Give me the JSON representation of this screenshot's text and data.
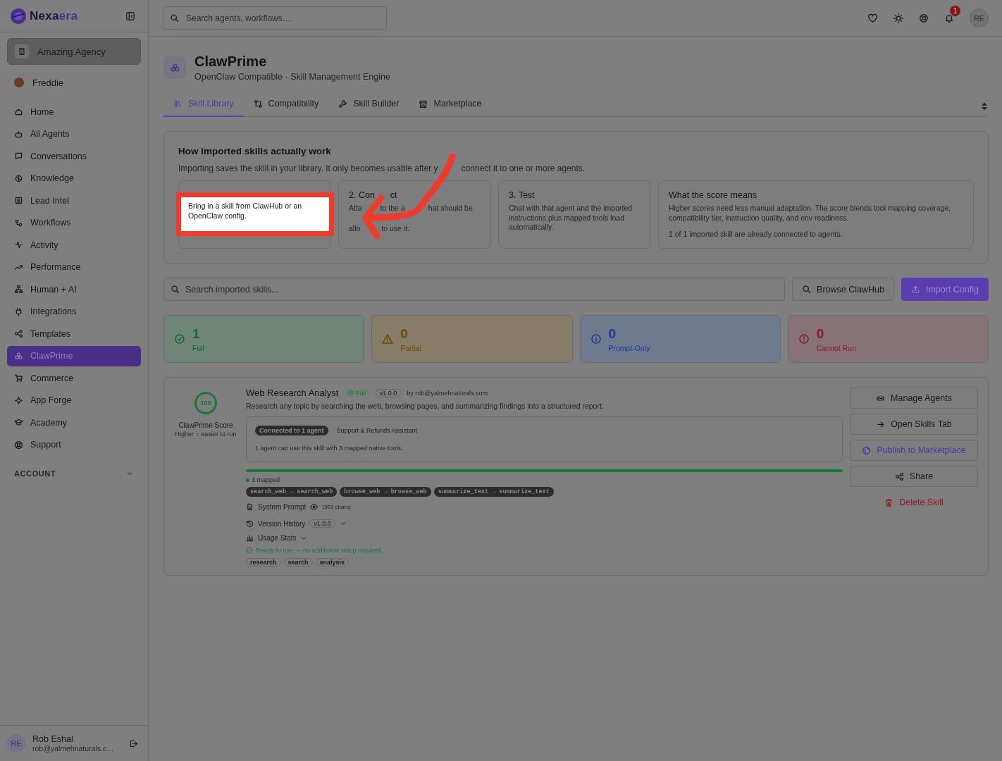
{
  "sidebar": {
    "logo": {
      "first": "Nexa",
      "second": "era"
    },
    "workspace": "Amazing Agency",
    "user": "Freddie",
    "items": [
      {
        "label": "Home",
        "selected": false
      },
      {
        "label": "All Agents",
        "selected": false
      },
      {
        "label": "Conversations",
        "selected": false
      },
      {
        "label": "Knowledge",
        "selected": false
      },
      {
        "label": "Lead Intel",
        "selected": false
      },
      {
        "label": "Workflows",
        "selected": false
      },
      {
        "label": "Activity",
        "selected": false
      },
      {
        "label": "Performance",
        "selected": false
      },
      {
        "label": "Human + AI",
        "selected": false
      },
      {
        "label": "Integrations",
        "selected": false
      },
      {
        "label": "Templates",
        "selected": false
      },
      {
        "label": "ClawPrime",
        "selected": true
      },
      {
        "label": "Commerce",
        "selected": false
      },
      {
        "label": "App Forge",
        "selected": false
      },
      {
        "label": "Academy",
        "selected": false
      },
      {
        "label": "Support",
        "selected": false
      }
    ],
    "section": "ACCOUNT",
    "account": {
      "initials": "RE",
      "name": "Rob Eshal",
      "email": "rob@yalmehnaturals.c…"
    }
  },
  "topbar": {
    "search": {
      "placeholder": "Search agents, workflows…"
    },
    "notifications": "1",
    "avatar": "RE"
  },
  "header": {
    "title": "ClawPrime",
    "subtitle": "OpenClaw Compatible · Skill Management Engine"
  },
  "tabs": [
    {
      "label": "Skill Library",
      "selected": true
    },
    {
      "label": "Compatibility",
      "selected": false
    },
    {
      "label": "Skill Builder",
      "selected": false
    },
    {
      "label": "Marketplace",
      "selected": false
    }
  ],
  "guide": {
    "title": "How imported skills actually work",
    "intro": [
      "Importing saves the skill in your library. It only becomes usable after y",
      "connect it to one or more agents."
    ],
    "steps": [
      {
        "kind": "highlighted",
        "text": "Bring in a skill from ClawHub or an OpenClaw config."
      },
      {
        "kind": "covered",
        "title": [
          "2. Con",
          "ct"
        ],
        "lines": [
          [
            "Atta",
            "to the a",
            "hat should be"
          ],
          [
            "allo",
            "to use it."
          ]
        ]
      },
      {
        "kind": "step",
        "title": "3. Test",
        "text": "Chat with that agent and the imported instructions plus mapped tools load automatically."
      },
      {
        "kind": "score",
        "title": "What the score means",
        "text": "Higher scores need less manual adaptation. The score blends tool mapping coverage, compatibility tier, instruction quality, and env readiness.",
        "note": "1 of 1 imported skill are already connected to agents."
      }
    ]
  },
  "toolbar": {
    "search": {
      "placeholder": "Search imported skills..."
    },
    "browse": "Browse ClawHub",
    "import": "Import Config"
  },
  "stats": [
    {
      "kind": "full",
      "value": "1",
      "label": "Full"
    },
    {
      "kind": "partial",
      "value": "0",
      "label": "Partial"
    },
    {
      "kind": "prompt",
      "value": "0",
      "label": "Prompt-Only"
    },
    {
      "kind": "cannot",
      "value": "0",
      "label": "Cannot Run"
    }
  ],
  "skill": {
    "score": "100",
    "score_label": "ClawPrime Score",
    "score_hint": "Higher = easier to run",
    "name": "Web Research Analyst",
    "tier": "Full",
    "version": "v1.0.0",
    "author": "by rob@yalmehnaturals.com",
    "description": "Research any topic by searching the web, browsing pages, and summarizing findings into a structured report.",
    "connection": {
      "chip": "Connected to 1 agent",
      "agent": "Support & Refunds Assistant",
      "text": "1 agent can use this skill with 3 mapped native tools."
    },
    "mapping": {
      "level": 1,
      "label": "3 mapped",
      "tools": [
        "search_web → search_web",
        "browse_web → browse_web",
        "summarize_text → summarize_text"
      ]
    },
    "prompt": {
      "label": "System Prompt",
      "chars": "(303 chars)"
    },
    "history": {
      "label": "Version History",
      "version": "v1.0.0",
      "expanded": false
    },
    "usage": {
      "label": "Usage Stats",
      "expanded": false
    },
    "ready": "Ready to use — no additional setup required",
    "tags": [
      "research",
      "search",
      "analysis"
    ],
    "actions": [
      {
        "kind": "default",
        "label": "Manage Agents"
      },
      {
        "kind": "default",
        "label": "Open Skills Tab"
      },
      {
        "kind": "accent",
        "label": "Publish to Marketplace"
      },
      {
        "kind": "default",
        "label": "Share"
      },
      {
        "kind": "danger",
        "label": "Delete Skill"
      }
    ]
  }
}
